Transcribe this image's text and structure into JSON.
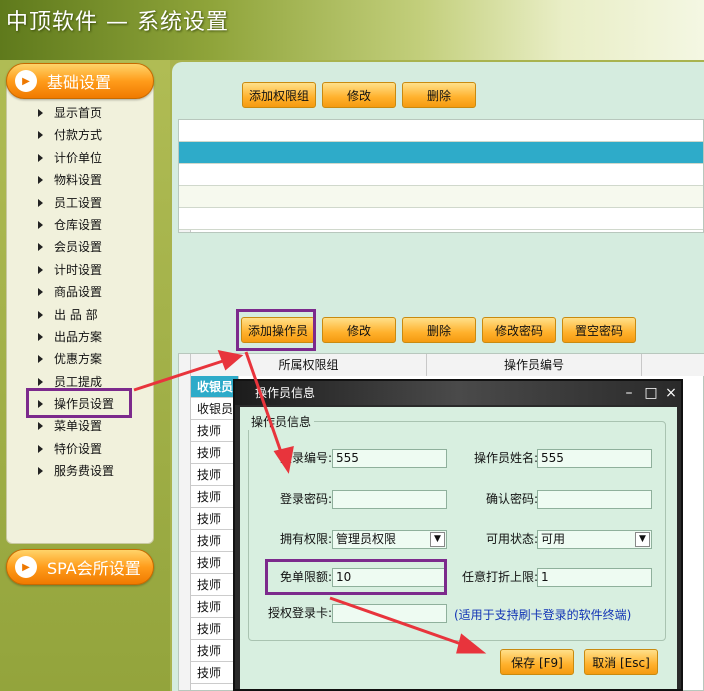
{
  "header": {
    "title": "中顶软件 — 系统设置"
  },
  "sidebar": {
    "section_basic": "基础设置",
    "items": [
      {
        "label": "显示首页"
      },
      {
        "label": "付款方式"
      },
      {
        "label": "计价单位"
      },
      {
        "label": "物料设置"
      },
      {
        "label": "员工设置"
      },
      {
        "label": "仓库设置"
      },
      {
        "label": "会员设置"
      },
      {
        "label": "计时设置"
      },
      {
        "label": "商品设置"
      },
      {
        "label": "出 品 部"
      },
      {
        "label": "出品方案"
      },
      {
        "label": "优惠方案"
      },
      {
        "label": "员工提成"
      },
      {
        "label": "操作员设置"
      },
      {
        "label": "菜单设置"
      },
      {
        "label": "特价设置"
      },
      {
        "label": "服务费设置"
      }
    ],
    "section_spa": "SPA会所设置"
  },
  "group_toolbar": {
    "add": "添加权限组",
    "edit": "修改",
    "delete": "删除"
  },
  "operator_toolbar": {
    "add": "添加操作员",
    "edit": "修改",
    "delete": "删除",
    "change_pwd": "修改密码",
    "clear_pwd": "置空密码"
  },
  "operator_table": {
    "columns": [
      "所属权限组",
      "操作员编号"
    ],
    "rows": [
      "收银员",
      "收银员",
      "技师",
      "技师",
      "技师",
      "技师",
      "技师",
      "技师",
      "技师",
      "技师",
      "技师",
      "技师",
      "技师",
      "技师"
    ]
  },
  "dialog": {
    "title": "操作员信息",
    "group": "操作员信息",
    "login_no_label": "登录编号:",
    "login_no": "555",
    "name_label": "操作员姓名:",
    "name": "555",
    "password_label": "登录密码:",
    "password": "",
    "confirm_label": "确认密码:",
    "confirm": "",
    "perm_label": "拥有权限:",
    "perm": "管理员权限",
    "status_label": "可用状态:",
    "status": "可用",
    "free_label": "免单限额:",
    "free": "10",
    "discount_label": "任意打折上限:",
    "discount": "1",
    "card_label": "授权登录卡:",
    "card": "",
    "card_hint": "(适用于支持刷卡登录的软件终端)",
    "save": "保存 [F9]",
    "cancel": "取消 [Esc]"
  }
}
